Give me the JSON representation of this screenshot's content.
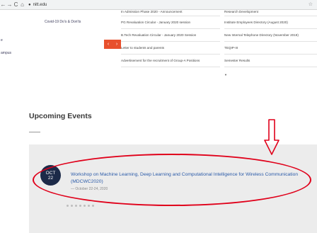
{
  "browser": {
    "back_icon": "←",
    "forward_icon": "→",
    "reload_icon": "C",
    "home_icon": "⌂",
    "url": "nitt.edu",
    "bookmark_icon": "☆"
  },
  "left_links": [
    "Covid-19 Do's & Don'ts",
    "e",
    "ampus"
  ],
  "slider_arrows": [
    "‹",
    "›"
  ],
  "notices": {
    "column_a": [
      "In Admission Phase 2020 - Announcement",
      "PG Revaluation Circular - January 2020 session",
      "B.Tech Revaluation Circular - January 2020 Session",
      "Letter to students and parents",
      "Advertisement for the recruitment of Group-A Positions"
    ],
    "column_b": [
      "Research Development",
      "Institute Employees Directory (August 2020)",
      "New Internal Telephone Directory (November 2019)",
      "TEQIP-III",
      "Semester Results"
    ],
    "scroll_marker": "▼"
  },
  "section": {
    "title": "Upcoming Events"
  },
  "event": {
    "month": "OCT",
    "day": "22",
    "title": "Workshop on Machine Learning, Deep Learning and Computational Intelligence for Wireless Communication (MDCWC2020)",
    "date": "— October 22-24, 2020"
  },
  "annotation": {
    "color": "#e0001a"
  },
  "accent_color": "#e8502d",
  "badge_color": "#1c2a48"
}
